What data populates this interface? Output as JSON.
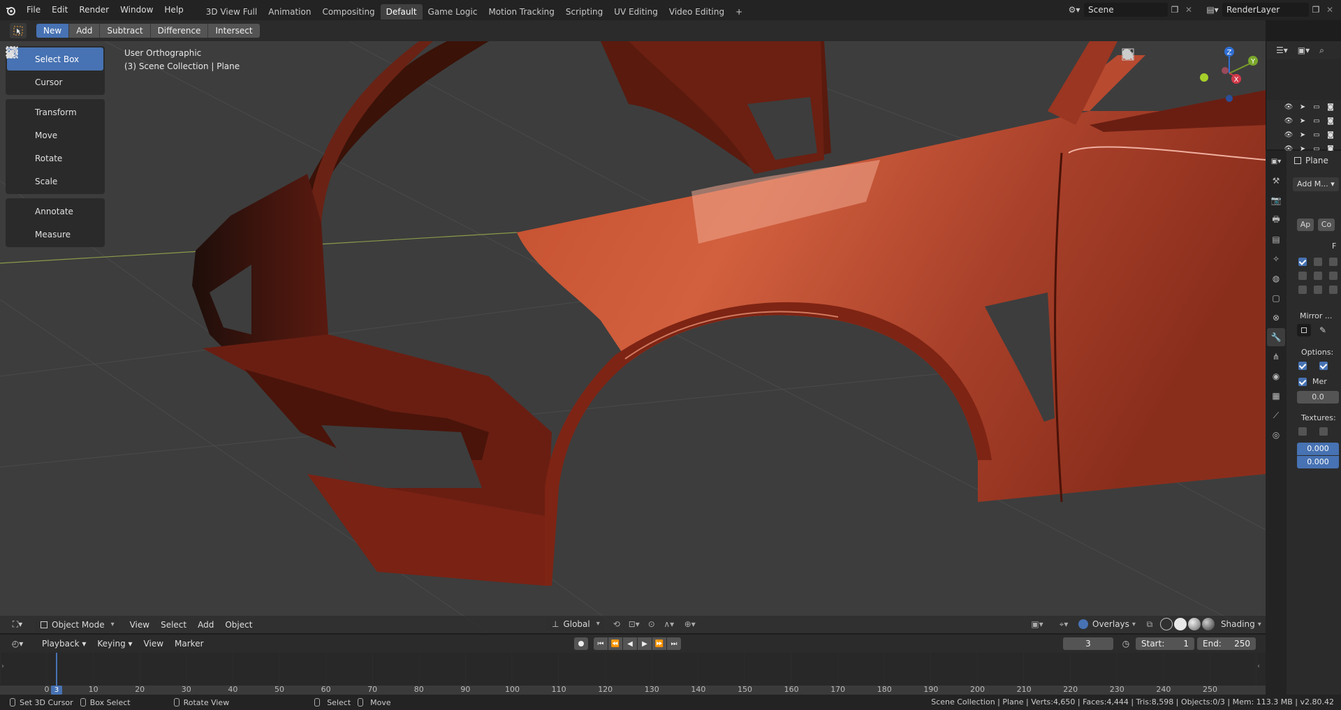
{
  "topbar": {
    "menus": [
      "File",
      "Edit",
      "Render",
      "Window",
      "Help"
    ],
    "workspaces": [
      "3D View Full",
      "Animation",
      "Compositing",
      "Default",
      "Game Logic",
      "Motion Tracking",
      "Scripting",
      "UV Editing",
      "Video Editing"
    ],
    "active_workspace": "Default",
    "add_tab": "+",
    "scene": "Scene",
    "render_layer": "RenderLayer"
  },
  "tool_header": {
    "modes": [
      "New",
      "Add",
      "Subtract",
      "Difference",
      "Intersect"
    ]
  },
  "toolbar": {
    "select_box": "Select Box",
    "cursor": "Cursor",
    "transform": "Transform",
    "move": "Move",
    "rotate": "Rotate",
    "scale": "Scale",
    "annotate": "Annotate",
    "measure": "Measure"
  },
  "viewport": {
    "view_name": "User Orthographic",
    "collection_info": "(3) Scene Collection | Plane",
    "gizmo": {
      "z": "Z",
      "y": "Y",
      "x": "X"
    }
  },
  "vp_header": {
    "mode": "Object Mode",
    "menus": [
      "View",
      "Select",
      "Add",
      "Object"
    ],
    "orientation": "Global",
    "overlays": "Overlays",
    "shading": "Shading"
  },
  "timeline": {
    "menus": [
      "Playback",
      "Keying",
      "View",
      "Marker"
    ],
    "current_frame": "3",
    "start_label": "Start:",
    "start": "1",
    "end_label": "End:",
    "end": "250",
    "ticks": [
      "0",
      "10",
      "20",
      "30",
      "40",
      "50",
      "60",
      "70",
      "80",
      "90",
      "100",
      "110",
      "120",
      "130",
      "140",
      "150",
      "160",
      "170",
      "180",
      "190",
      "200",
      "210",
      "220",
      "230",
      "240",
      "250"
    ],
    "playhead": "3"
  },
  "statusbar": {
    "set_cursor": "Set 3D Cursor",
    "box_select": "Box Select",
    "rotate_view": "Rotate View",
    "select": "Select",
    "move": "Move",
    "stats": "Scene Collection | Plane | Verts:4,650 | Faces:4,444 | Tris:8,598 | Objects:0/3 | Mem: 113.3 MB | v2.80.42"
  },
  "properties": {
    "object_name": "Plane",
    "add_modifier": "Add M...",
    "apply": "Ap",
    "copy": "Co",
    "f_label": "F",
    "mirror_object": "Mirror ...",
    "options": "Options:",
    "merge": "Mer",
    "merge_value": "0.0",
    "textures": "Textures:",
    "offset_u": "0.000",
    "offset_v": "0.000"
  },
  "colors": {
    "accent": "#4772b3",
    "car_body": "#a13a22"
  }
}
